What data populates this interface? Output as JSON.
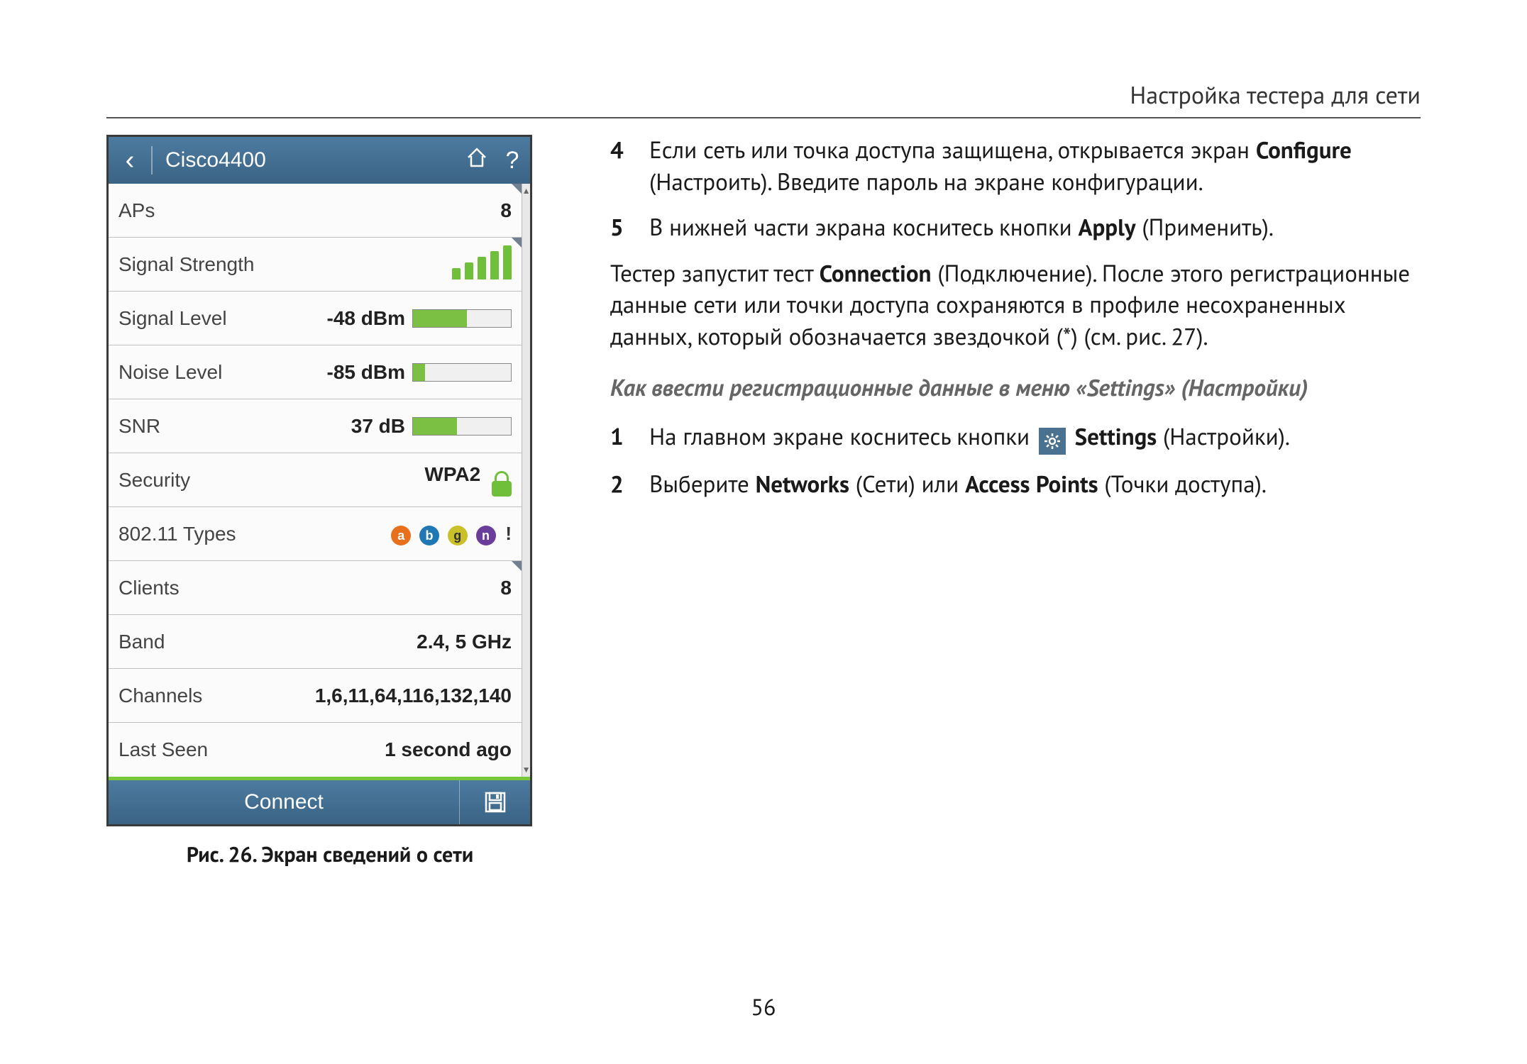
{
  "header": {
    "title": "Настройка тестера для сети"
  },
  "page_number": "56",
  "device": {
    "titlebar": {
      "title": "Cisco4400"
    },
    "rows": {
      "aps": {
        "label": "APs",
        "value": "8"
      },
      "signal_strength": {
        "label": "Signal Strength"
      },
      "signal_level": {
        "label": "Signal Level",
        "value": "-48 dBm",
        "bar_pct": 55
      },
      "noise_level": {
        "label": "Noise Level",
        "value": "-85 dBm",
        "bar_pct": 12
      },
      "snr": {
        "label": "SNR",
        "value": "37 dB",
        "bar_pct": 45
      },
      "security": {
        "label": "Security",
        "value": "WPA2"
      },
      "types": {
        "label": "802.11 Types",
        "dots": [
          "a",
          "b",
          "g",
          "n"
        ]
      },
      "clients": {
        "label": "Clients",
        "value": "8"
      },
      "band": {
        "label": "Band",
        "value": "2.4, 5 GHz"
      },
      "channels": {
        "label": "Channels",
        "value": "1,6,11,64,116,132,140"
      },
      "last_seen": {
        "label": "Last Seen",
        "value": "1  second ago"
      }
    },
    "footer": {
      "connect": "Connect"
    }
  },
  "caption": "Рис. 26. Экран сведений о сети",
  "right": {
    "step4": {
      "num": "4",
      "text_pre": "Если сеть или точка доступа защищена, открывается экран ",
      "bold1": "Configure",
      "text_mid": " (Настроить). Введите пароль на экране конфигурации."
    },
    "step5": {
      "num": "5",
      "text_pre": "В нижней части экрана коснитесь кнопки ",
      "bold1": "Apply",
      "text_post": " (Применить)."
    },
    "para1": {
      "pre": "Тестер запустит тест ",
      "bold": "Connection",
      "post": " (Подключение). После этого регистрационные данные сети или точки доступа сохраняются в профиле несохраненных данных, который обозначается звездочкой (*) (см. рис. 27)."
    },
    "subhead": "Как ввести регистрационные данные в меню «Settings» (Настройки)",
    "step1": {
      "num": "1",
      "text_pre": "На главном экране коснитесь кнопки ",
      "bold1": "Settings",
      "text_post": " (Настройки)."
    },
    "step2": {
      "num": "2",
      "text_pre": "Выберите ",
      "bold1": "Networks",
      "mid1": " (Сети) или ",
      "bold2": "Access Points",
      "text_post": " (Точки доступа)."
    }
  }
}
